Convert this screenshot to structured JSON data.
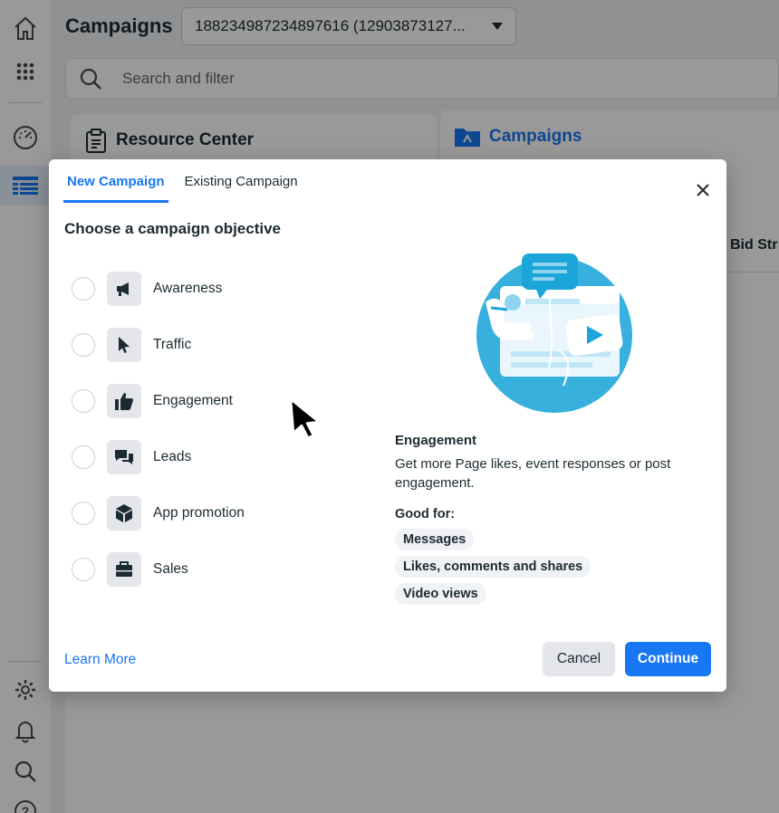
{
  "app": {
    "page_title": "Campaigns",
    "account_selector": "188234987234897616 (12903873127...",
    "search_placeholder": "Search and filter",
    "resource_center_title": "Resource Center",
    "campaigns_panel_title": "Campaigns",
    "table_column": "Bid Str"
  },
  "nav": {
    "top": [
      {
        "name": "home",
        "icon": "home-icon"
      },
      {
        "name": "all-tools",
        "icon": "grid-dots-icon"
      },
      {
        "name": "dashboard",
        "icon": "gauge-icon"
      },
      {
        "name": "ads-manager",
        "icon": "table-icon",
        "active": true
      }
    ],
    "bottom": [
      {
        "name": "settings",
        "icon": "gear-icon"
      },
      {
        "name": "notifications",
        "icon": "bell-icon"
      },
      {
        "name": "search",
        "icon": "search-icon"
      },
      {
        "name": "help",
        "icon": "help-icon"
      }
    ]
  },
  "modal": {
    "tabs": [
      {
        "label": "New Campaign",
        "active": true
      },
      {
        "label": "Existing Campaign",
        "active": false
      }
    ],
    "heading": "Choose a campaign objective",
    "objectives": [
      {
        "label": "Awareness",
        "icon": "megaphone-icon"
      },
      {
        "label": "Traffic",
        "icon": "cursor-icon"
      },
      {
        "label": "Engagement",
        "icon": "thumbs-up-icon"
      },
      {
        "label": "Leads",
        "icon": "chat-bubbles-icon"
      },
      {
        "label": "App promotion",
        "icon": "cube-icon"
      },
      {
        "label": "Sales",
        "icon": "briefcase-icon"
      }
    ],
    "detail": {
      "title": "Engagement",
      "description": "Get more Page likes, event responses or post engagement.",
      "good_for_label": "Good for:",
      "good_for": [
        "Messages",
        "Likes, comments and shares",
        "Video views"
      ]
    },
    "learn_more": "Learn More",
    "cancel_label": "Cancel",
    "continue_label": "Continue"
  },
  "colors": {
    "accent": "#1877f2",
    "text": "#1c2b33",
    "overlay": "rgba(0,0,0,0.40)",
    "chip_bg": "#f0f2f5"
  }
}
